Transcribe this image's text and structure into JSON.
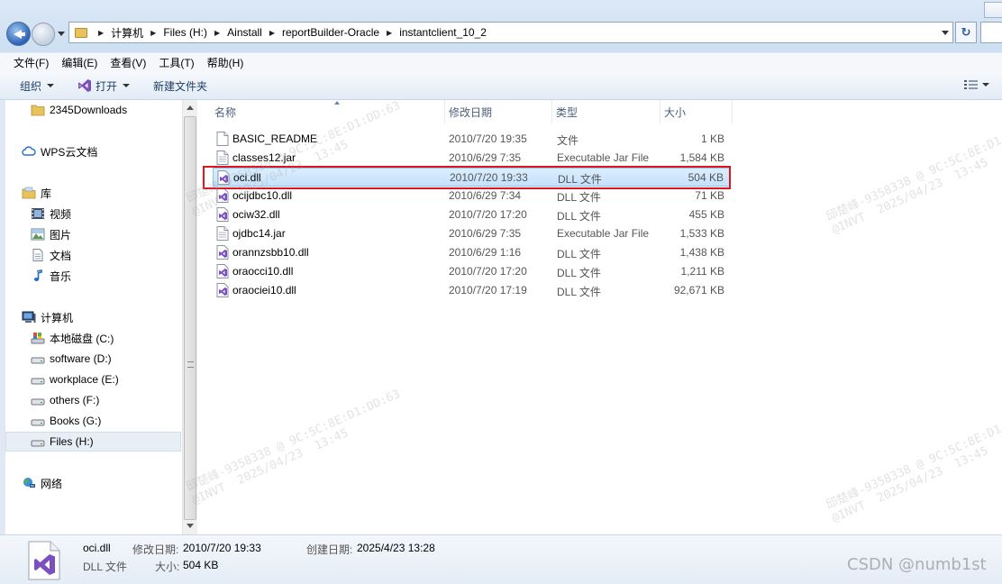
{
  "address": {
    "crumbs": [
      "计算机",
      "Files (H:)",
      "Ainstall",
      "reportBuilder-Oracle",
      "instantclient_10_2"
    ]
  },
  "menu": [
    "文件(F)",
    "编辑(E)",
    "查看(V)",
    "工具(T)",
    "帮助(H)"
  ],
  "toolbar": {
    "organize": "组织",
    "open": "打开",
    "new_folder": "新建文件夹"
  },
  "nav": {
    "downloads": "2345Downloads",
    "wps": "WPS云文档",
    "library": "库",
    "video": "视频",
    "pictures": "图片",
    "documents": "文档",
    "music": "音乐",
    "computer": "计算机",
    "drive_c": "本地磁盘 (C:)",
    "drive_d": "software (D:)",
    "drive_e": "workplace (E:)",
    "drive_f": "others (F:)",
    "drive_g": "Books (G:)",
    "drive_h": "Files (H:)",
    "network": "网络"
  },
  "columns": {
    "name": "名称",
    "date": "修改日期",
    "type": "类型",
    "size": "大小"
  },
  "files": [
    {
      "name": "BASIC_README",
      "date": "2010/7/20 19:35",
      "type": "文件",
      "size": "1 KB",
      "icon": "text-file-icon"
    },
    {
      "name": "classes12.jar",
      "date": "2010/6/29 7:35",
      "type": "Executable Jar File",
      "size": "1,584 KB",
      "icon": "jar-file-icon"
    },
    {
      "name": "oci.dll",
      "date": "2010/7/20 19:33",
      "type": "DLL 文件",
      "size": "504 KB",
      "icon": "dll-file-icon",
      "selected": true
    },
    {
      "name": "ocijdbc10.dll",
      "date": "2010/6/29 7:34",
      "type": "DLL 文件",
      "size": "71 KB",
      "icon": "dll-file-icon"
    },
    {
      "name": "ociw32.dll",
      "date": "2010/7/20 17:20",
      "type": "DLL 文件",
      "size": "455 KB",
      "icon": "dll-file-icon"
    },
    {
      "name": "ojdbc14.jar",
      "date": "2010/6/29 7:35",
      "type": "Executable Jar File",
      "size": "1,533 KB",
      "icon": "jar-file-icon"
    },
    {
      "name": "orannzsbb10.dll",
      "date": "2010/6/29 1:16",
      "type": "DLL 文件",
      "size": "1,438 KB",
      "icon": "dll-file-icon"
    },
    {
      "name": "oraocci10.dll",
      "date": "2010/7/20 17:20",
      "type": "DLL 文件",
      "size": "1,211 KB",
      "icon": "dll-file-icon"
    },
    {
      "name": "oraociei10.dll",
      "date": "2010/7/20 17:19",
      "type": "DLL 文件",
      "size": "92,671 KB",
      "icon": "dll-file-icon"
    }
  ],
  "details": {
    "filename": "oci.dll",
    "filetype": "DLL 文件",
    "modified_label": "修改日期:",
    "modified_value": "2010/7/20 19:33",
    "created_label": "创建日期:",
    "created_value": "2025/4/23 13:28",
    "size_label": "大小:",
    "size_value": "504 KB"
  },
  "watermark": {
    "line1": "邱楚峰-9358338 @ 9C:5C:8E:D1:DD:63",
    "line2": "@INVT  2025/04/23  13:45"
  },
  "credit": "CSDN @numb1st",
  "colors": {
    "highlight_box": "#e0141f",
    "selection": "#c5e1fb",
    "vs_purple": "#7b4fbf"
  }
}
